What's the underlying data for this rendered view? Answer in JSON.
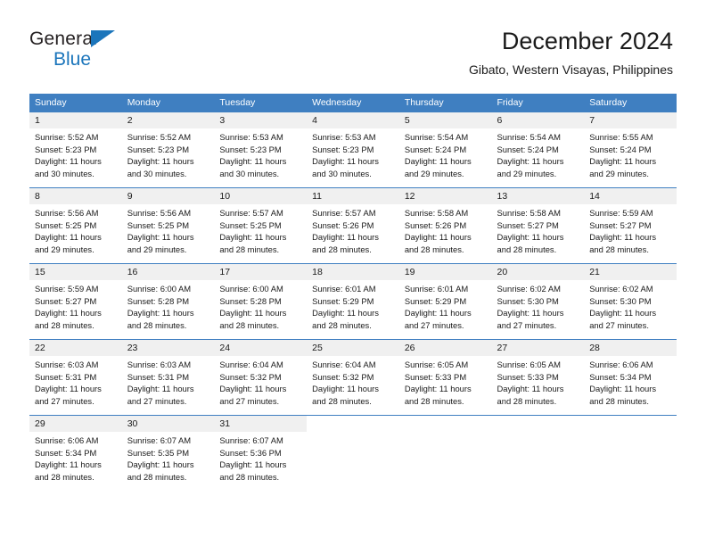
{
  "brand": {
    "name_top": "General",
    "name_bottom": "Blue",
    "triangle_color": "#1b75bb"
  },
  "header": {
    "title": "December 2024",
    "subtitle": "Gibato, Western Visayas, Philippines"
  },
  "colors": {
    "header_blue": "#3f7fc1",
    "daynum_bg": "#f0f0f0",
    "text": "#1a1a1a"
  },
  "weekday_headers": [
    "Sunday",
    "Monday",
    "Tuesday",
    "Wednesday",
    "Thursday",
    "Friday",
    "Saturday"
  ],
  "weeks": [
    [
      {
        "day": "1",
        "sunrise": "Sunrise: 5:52 AM",
        "sunset": "Sunset: 5:23 PM",
        "daylight1": "Daylight: 11 hours",
        "daylight2": "and 30 minutes."
      },
      {
        "day": "2",
        "sunrise": "Sunrise: 5:52 AM",
        "sunset": "Sunset: 5:23 PM",
        "daylight1": "Daylight: 11 hours",
        "daylight2": "and 30 minutes."
      },
      {
        "day": "3",
        "sunrise": "Sunrise: 5:53 AM",
        "sunset": "Sunset: 5:23 PM",
        "daylight1": "Daylight: 11 hours",
        "daylight2": "and 30 minutes."
      },
      {
        "day": "4",
        "sunrise": "Sunrise: 5:53 AM",
        "sunset": "Sunset: 5:23 PM",
        "daylight1": "Daylight: 11 hours",
        "daylight2": "and 30 minutes."
      },
      {
        "day": "5",
        "sunrise": "Sunrise: 5:54 AM",
        "sunset": "Sunset: 5:24 PM",
        "daylight1": "Daylight: 11 hours",
        "daylight2": "and 29 minutes."
      },
      {
        "day": "6",
        "sunrise": "Sunrise: 5:54 AM",
        "sunset": "Sunset: 5:24 PM",
        "daylight1": "Daylight: 11 hours",
        "daylight2": "and 29 minutes."
      },
      {
        "day": "7",
        "sunrise": "Sunrise: 5:55 AM",
        "sunset": "Sunset: 5:24 PM",
        "daylight1": "Daylight: 11 hours",
        "daylight2": "and 29 minutes."
      }
    ],
    [
      {
        "day": "8",
        "sunrise": "Sunrise: 5:56 AM",
        "sunset": "Sunset: 5:25 PM",
        "daylight1": "Daylight: 11 hours",
        "daylight2": "and 29 minutes."
      },
      {
        "day": "9",
        "sunrise": "Sunrise: 5:56 AM",
        "sunset": "Sunset: 5:25 PM",
        "daylight1": "Daylight: 11 hours",
        "daylight2": "and 29 minutes."
      },
      {
        "day": "10",
        "sunrise": "Sunrise: 5:57 AM",
        "sunset": "Sunset: 5:25 PM",
        "daylight1": "Daylight: 11 hours",
        "daylight2": "and 28 minutes."
      },
      {
        "day": "11",
        "sunrise": "Sunrise: 5:57 AM",
        "sunset": "Sunset: 5:26 PM",
        "daylight1": "Daylight: 11 hours",
        "daylight2": "and 28 minutes."
      },
      {
        "day": "12",
        "sunrise": "Sunrise: 5:58 AM",
        "sunset": "Sunset: 5:26 PM",
        "daylight1": "Daylight: 11 hours",
        "daylight2": "and 28 minutes."
      },
      {
        "day": "13",
        "sunrise": "Sunrise: 5:58 AM",
        "sunset": "Sunset: 5:27 PM",
        "daylight1": "Daylight: 11 hours",
        "daylight2": "and 28 minutes."
      },
      {
        "day": "14",
        "sunrise": "Sunrise: 5:59 AM",
        "sunset": "Sunset: 5:27 PM",
        "daylight1": "Daylight: 11 hours",
        "daylight2": "and 28 minutes."
      }
    ],
    [
      {
        "day": "15",
        "sunrise": "Sunrise: 5:59 AM",
        "sunset": "Sunset: 5:27 PM",
        "daylight1": "Daylight: 11 hours",
        "daylight2": "and 28 minutes."
      },
      {
        "day": "16",
        "sunrise": "Sunrise: 6:00 AM",
        "sunset": "Sunset: 5:28 PM",
        "daylight1": "Daylight: 11 hours",
        "daylight2": "and 28 minutes."
      },
      {
        "day": "17",
        "sunrise": "Sunrise: 6:00 AM",
        "sunset": "Sunset: 5:28 PM",
        "daylight1": "Daylight: 11 hours",
        "daylight2": "and 28 minutes."
      },
      {
        "day": "18",
        "sunrise": "Sunrise: 6:01 AM",
        "sunset": "Sunset: 5:29 PM",
        "daylight1": "Daylight: 11 hours",
        "daylight2": "and 28 minutes."
      },
      {
        "day": "19",
        "sunrise": "Sunrise: 6:01 AM",
        "sunset": "Sunset: 5:29 PM",
        "daylight1": "Daylight: 11 hours",
        "daylight2": "and 27 minutes."
      },
      {
        "day": "20",
        "sunrise": "Sunrise: 6:02 AM",
        "sunset": "Sunset: 5:30 PM",
        "daylight1": "Daylight: 11 hours",
        "daylight2": "and 27 minutes."
      },
      {
        "day": "21",
        "sunrise": "Sunrise: 6:02 AM",
        "sunset": "Sunset: 5:30 PM",
        "daylight1": "Daylight: 11 hours",
        "daylight2": "and 27 minutes."
      }
    ],
    [
      {
        "day": "22",
        "sunrise": "Sunrise: 6:03 AM",
        "sunset": "Sunset: 5:31 PM",
        "daylight1": "Daylight: 11 hours",
        "daylight2": "and 27 minutes."
      },
      {
        "day": "23",
        "sunrise": "Sunrise: 6:03 AM",
        "sunset": "Sunset: 5:31 PM",
        "daylight1": "Daylight: 11 hours",
        "daylight2": "and 27 minutes."
      },
      {
        "day": "24",
        "sunrise": "Sunrise: 6:04 AM",
        "sunset": "Sunset: 5:32 PM",
        "daylight1": "Daylight: 11 hours",
        "daylight2": "and 27 minutes."
      },
      {
        "day": "25",
        "sunrise": "Sunrise: 6:04 AM",
        "sunset": "Sunset: 5:32 PM",
        "daylight1": "Daylight: 11 hours",
        "daylight2": "and 28 minutes."
      },
      {
        "day": "26",
        "sunrise": "Sunrise: 6:05 AM",
        "sunset": "Sunset: 5:33 PM",
        "daylight1": "Daylight: 11 hours",
        "daylight2": "and 28 minutes."
      },
      {
        "day": "27",
        "sunrise": "Sunrise: 6:05 AM",
        "sunset": "Sunset: 5:33 PM",
        "daylight1": "Daylight: 11 hours",
        "daylight2": "and 28 minutes."
      },
      {
        "day": "28",
        "sunrise": "Sunrise: 6:06 AM",
        "sunset": "Sunset: 5:34 PM",
        "daylight1": "Daylight: 11 hours",
        "daylight2": "and 28 minutes."
      }
    ],
    [
      {
        "day": "29",
        "sunrise": "Sunrise: 6:06 AM",
        "sunset": "Sunset: 5:34 PM",
        "daylight1": "Daylight: 11 hours",
        "daylight2": "and 28 minutes."
      },
      {
        "day": "30",
        "sunrise": "Sunrise: 6:07 AM",
        "sunset": "Sunset: 5:35 PM",
        "daylight1": "Daylight: 11 hours",
        "daylight2": "and 28 minutes."
      },
      {
        "day": "31",
        "sunrise": "Sunrise: 6:07 AM",
        "sunset": "Sunset: 5:36 PM",
        "daylight1": "Daylight: 11 hours",
        "daylight2": "and 28 minutes."
      },
      {
        "day": "",
        "sunrise": "",
        "sunset": "",
        "daylight1": "",
        "daylight2": ""
      },
      {
        "day": "",
        "sunrise": "",
        "sunset": "",
        "daylight1": "",
        "daylight2": ""
      },
      {
        "day": "",
        "sunrise": "",
        "sunset": "",
        "daylight1": "",
        "daylight2": ""
      },
      {
        "day": "",
        "sunrise": "",
        "sunset": "",
        "daylight1": "",
        "daylight2": ""
      }
    ]
  ]
}
